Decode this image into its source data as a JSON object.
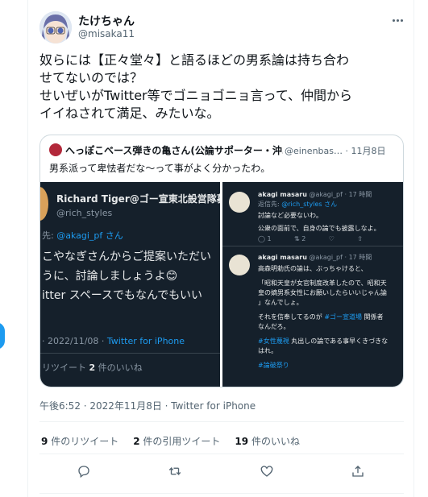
{
  "author": {
    "name": "たけちゃん",
    "handle": "@misaka11"
  },
  "tweet_text_lines": [
    "奴らには【正々堂々】と語るほどの男系論は持ち合わ",
    "せてないのでは？",
    "せいぜいがTwitter等でゴニョゴニョ言って、仲間から",
    "イイねされて満足、みたいな。"
  ],
  "quote": {
    "name": "へっぽこベース弾きの亀さん(公論サポーター・沖…",
    "handle_time": "@einenbas… · 11月8日",
    "text": "男系派って卑怯者だな〜って事がよく分かったわ。",
    "left_image": {
      "name": "Richard Tiger@ゴー宣東北設営隊募集…",
      "handle": "@rich_styles",
      "reply_prefix": "先:",
      "reply_handle": "@akagi_pf さん",
      "lines": [
        "こやなぎさんからご提案いただい",
        "うに、討論しましょうよ😊",
        "itter スペースでもなんでもいい"
      ],
      "time_prefix": "· 2022/11/08 ·",
      "client": "Twitter for iPhone",
      "stats_prefix": "リツイート",
      "likes_count": "2",
      "likes_label": "件のいいね"
    },
    "right_image": {
      "post1": {
        "name": "akagi masaru",
        "meta": "@akagi_pf · 17 時間",
        "reply_prefix": "返信先:",
        "reply_handle": "@rich_styles さん",
        "line1": "討論など必要ないわ。",
        "line2": "公衆の面前で、自身の論でも披露しなよ。",
        "reply_count": "1",
        "rt_count": "2"
      },
      "post2": {
        "name": "akagi masaru",
        "meta": "@akagi_pf · 17 時間",
        "lines": [
          "高森明勅氏の論は、ぶっちゃけると、",
          "「昭和天皇が女官制度改革したので、昭和天",
          "皇の嫡男系女性にお願いしたらいいじゃん論",
          "」なんでしょ。",
          "それを信奉してるのが",
          "なんだろ。",
          "丸出しの論である事早くきづきな",
          "はれ。"
        ],
        "tag1": "#ゴー宣道場",
        "tag1_after": " 関係者",
        "tag2": "#女性蔑視",
        "tag3": "#論破祭り"
      }
    }
  },
  "timestamp": "午後6:52 · 2022年11月8日 · Twitter for iPhone",
  "stats": {
    "retweets_count": "9",
    "retweets_label": "件のリツイート",
    "quotes_count": "2",
    "quotes_label": "件の引用ツイート",
    "likes_count": "19",
    "likes_label": "件のいいね"
  },
  "icons": {
    "more": "more-icon",
    "reply": "reply-icon",
    "retweet": "retweet-icon",
    "like": "like-icon",
    "share": "share-icon"
  },
  "colors": {
    "accent": "#1d9bf0",
    "text": "#0f1419",
    "secondary": "#536471",
    "media_bg": "#15202b"
  }
}
